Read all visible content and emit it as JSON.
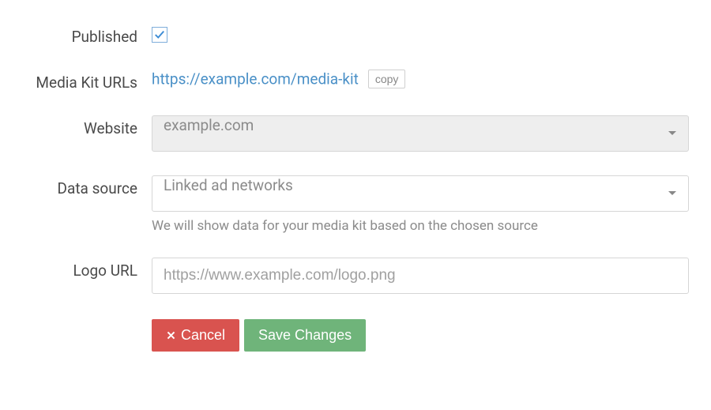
{
  "form": {
    "published": {
      "label": "Published",
      "checked": true
    },
    "mediaKitUrls": {
      "label": "Media Kit URLs",
      "url": "https://example.com/media-kit",
      "copyLabel": "copy"
    },
    "website": {
      "label": "Website",
      "value": "example.com"
    },
    "dataSource": {
      "label": "Data source",
      "value": "Linked ad networks",
      "helpText": "We will show data for your media kit based on the chosen source"
    },
    "logoUrl": {
      "label": "Logo URL",
      "placeholder": "https://www.example.com/logo.png"
    },
    "buttons": {
      "cancel": "Cancel",
      "save": "Save Changes"
    }
  }
}
